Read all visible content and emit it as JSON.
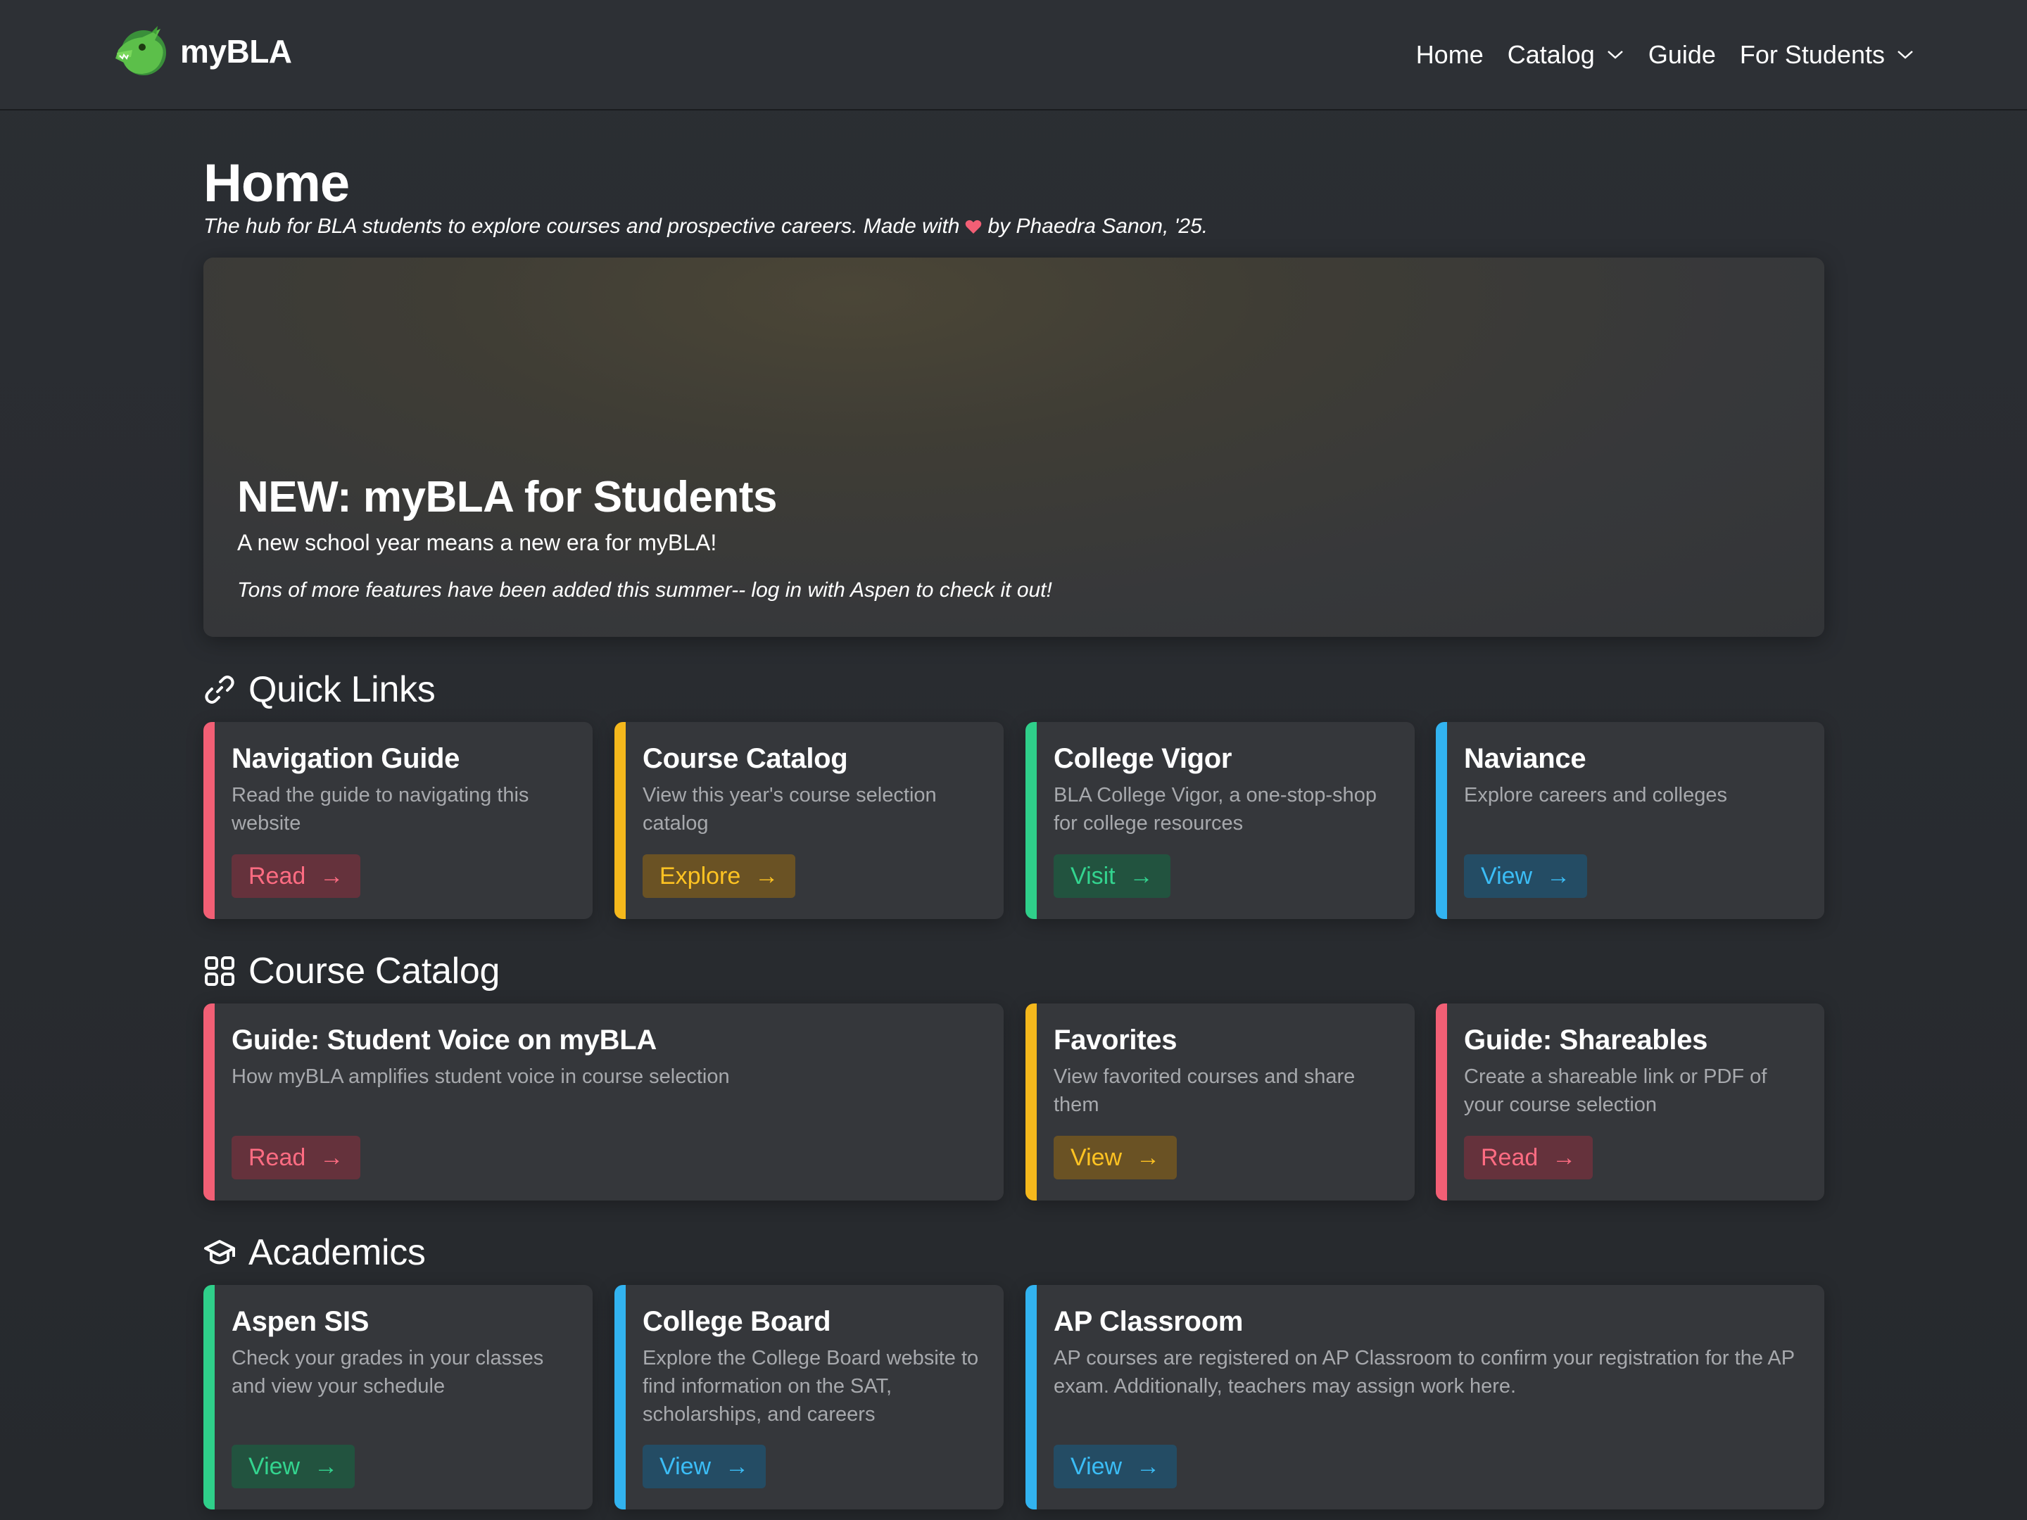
{
  "header": {
    "brand": "myBLA",
    "nav": [
      {
        "label": "Home"
      },
      {
        "label": "Catalog"
      },
      {
        "label": "Guide"
      },
      {
        "label": "For Students"
      }
    ]
  },
  "page": {
    "title": "Home",
    "subtitle_before": "The hub for BLA students to explore courses and prospective careers. Made with",
    "subtitle_after": "by Phaedra Sanon, '25."
  },
  "hero": {
    "title": "NEW: myBLA for Students",
    "subtitle": "A new school year means a new era for myBLA!",
    "note": "Tons of more features have been added this summer-- log in with Aspen to check it out!"
  },
  "sections": {
    "quick_links": {
      "title": "Quick Links",
      "icon": "link-icon",
      "cards": [
        {
          "title": "Navigation Guide",
          "desc": "Read the guide to navigating this website",
          "button": "Read",
          "color": "#f25f75"
        },
        {
          "title": "Course Catalog",
          "desc": "View this year's course selection catalog",
          "button": "Explore",
          "color": "#f5b81c"
        },
        {
          "title": "College Vigor",
          "desc": "BLA College Vigor, a one-stop-shop for college resources",
          "button": "Visit",
          "color": "#2fcf8a"
        },
        {
          "title": "Naviance",
          "desc": "Explore careers and colleges",
          "button": "View",
          "color": "#32b3f0"
        }
      ]
    },
    "course_catalog": {
      "title": "Course Catalog",
      "icon": "grid-icon",
      "cards": [
        {
          "title": "Guide: Student Voice on myBLA",
          "desc": "How myBLA amplifies student voice in course selection",
          "button": "Read",
          "color": "#f25f75"
        },
        {
          "title": "Favorites",
          "desc": "View favorited courses and share them",
          "button": "View",
          "color": "#f5b81c"
        },
        {
          "title": "Guide: Shareables",
          "desc": "Create a shareable link or PDF of your course selection",
          "button": "Read",
          "color": "#f25f75"
        }
      ]
    },
    "academics": {
      "title": "Academics",
      "icon": "graduation-cap-icon",
      "cards": [
        {
          "title": "Aspen SIS",
          "desc": "Check your grades in your classes and view your schedule",
          "button": "View",
          "color": "#2fcf8a"
        },
        {
          "title": "College Board",
          "desc": "Explore the College Board website to find information on the SAT, scholarships, and careers",
          "button": "View",
          "color": "#32b3f0"
        },
        {
          "title": "AP Classroom",
          "desc": "AP courses are registered on AP Classroom to confirm your registration for the AP exam. Additionally, teachers may assign work here.",
          "button": "View",
          "color": "#32b3f0"
        }
      ]
    }
  },
  "arrow_glyph": "→"
}
